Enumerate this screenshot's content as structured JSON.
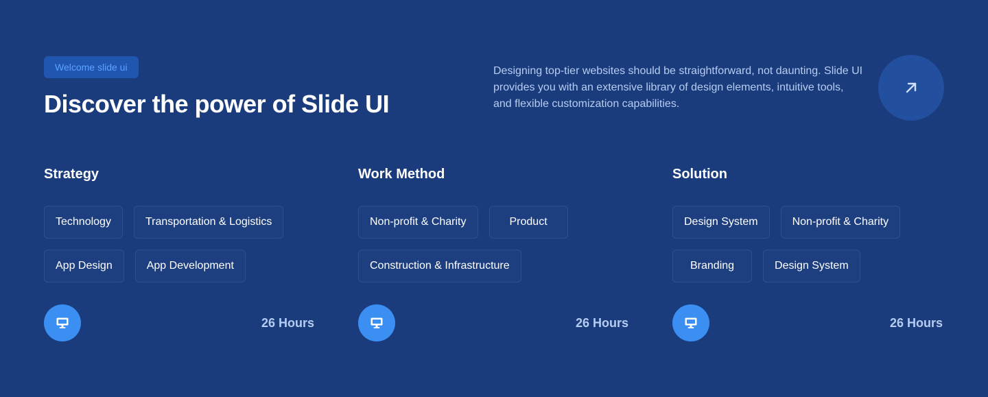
{
  "badge": "Welcome slide ui",
  "headline": "Discover the power of Slide UI",
  "intro": "Designing top-tier websites should be straightforward, not daunting. Slide UI provides you with an extensive library of design elements, intuitive tools, and flexible customization capabilities.",
  "arrow_icon": "arrow-up-right-icon",
  "columns": [
    {
      "title": "Strategy",
      "tags": [
        "Technology",
        "Transportation & Logistics",
        "App Design",
        "App Development"
      ],
      "hours": "26 Hours",
      "icon": "monitor-icon"
    },
    {
      "title": "Work Method",
      "tags": [
        "Non-profit & Charity",
        "Product",
        "Construction & Infrastructure"
      ],
      "hours": "26 Hours",
      "icon": "monitor-icon"
    },
    {
      "title": "Solution",
      "tags": [
        "Design System",
        "Non-profit & Charity",
        "Branding",
        "Design System"
      ],
      "hours": "26 Hours",
      "icon": "monitor-icon"
    }
  ],
  "colors": {
    "background": "#1b3c7c",
    "accent": "#3b8ef2",
    "badge_bg": "#2156b0",
    "muted_text": "#b6cdf3"
  }
}
